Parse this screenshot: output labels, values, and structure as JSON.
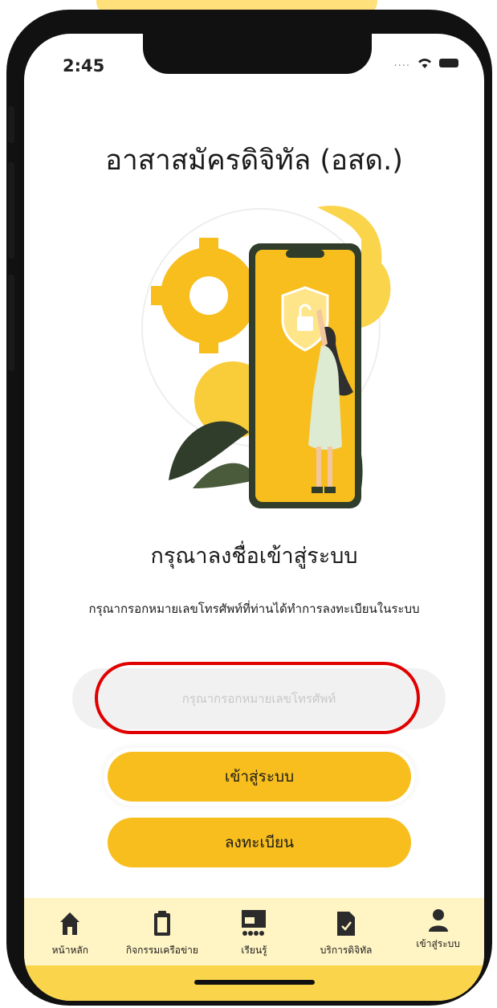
{
  "status_bar": {
    "time": "2:45",
    "signal": "....",
    "wifi_icon": "wifi-icon",
    "battery_icon": "battery-icon"
  },
  "app_title": "อาสาสมัครดิจิทัล (อสด.)",
  "illustration": {
    "icons": [
      "gear-icon",
      "smartphone-icon",
      "padlock-shield-icon",
      "woman-figure",
      "leaves"
    ]
  },
  "login": {
    "heading": "กรุณาลงชื่อเข้าสู่ระบบ",
    "subtext": "กรุณากรอกหมายเลขโทรศัพท์ที่ท่านได้ทำการลงทะเบียนในระบบ",
    "phone_placeholder": "กรุณากรอกหมายเลขโทรศัพท์",
    "phone_value": "",
    "login_button": "เข้าสู่ระบบ",
    "register_button": "ลงทะเบียน"
  },
  "bottom_nav": [
    {
      "label": "หน้าหลัก",
      "icon": "home-icon"
    },
    {
      "label": "กิจกรรมเครือข่าย",
      "icon": "clipboard-icon"
    },
    {
      "label": "เรียนรู้",
      "icon": "learning-board-icon"
    },
    {
      "label": "บริการดิจิทัล",
      "icon": "document-check-icon"
    },
    {
      "label": "เข้าสู่ระบบ",
      "icon": "user-icon"
    }
  ],
  "colors": {
    "accent": "#F7BE1E",
    "highlight": "#E00000",
    "nav_bg": "#FFF4C4",
    "bottom_band": "#FAD44A"
  }
}
